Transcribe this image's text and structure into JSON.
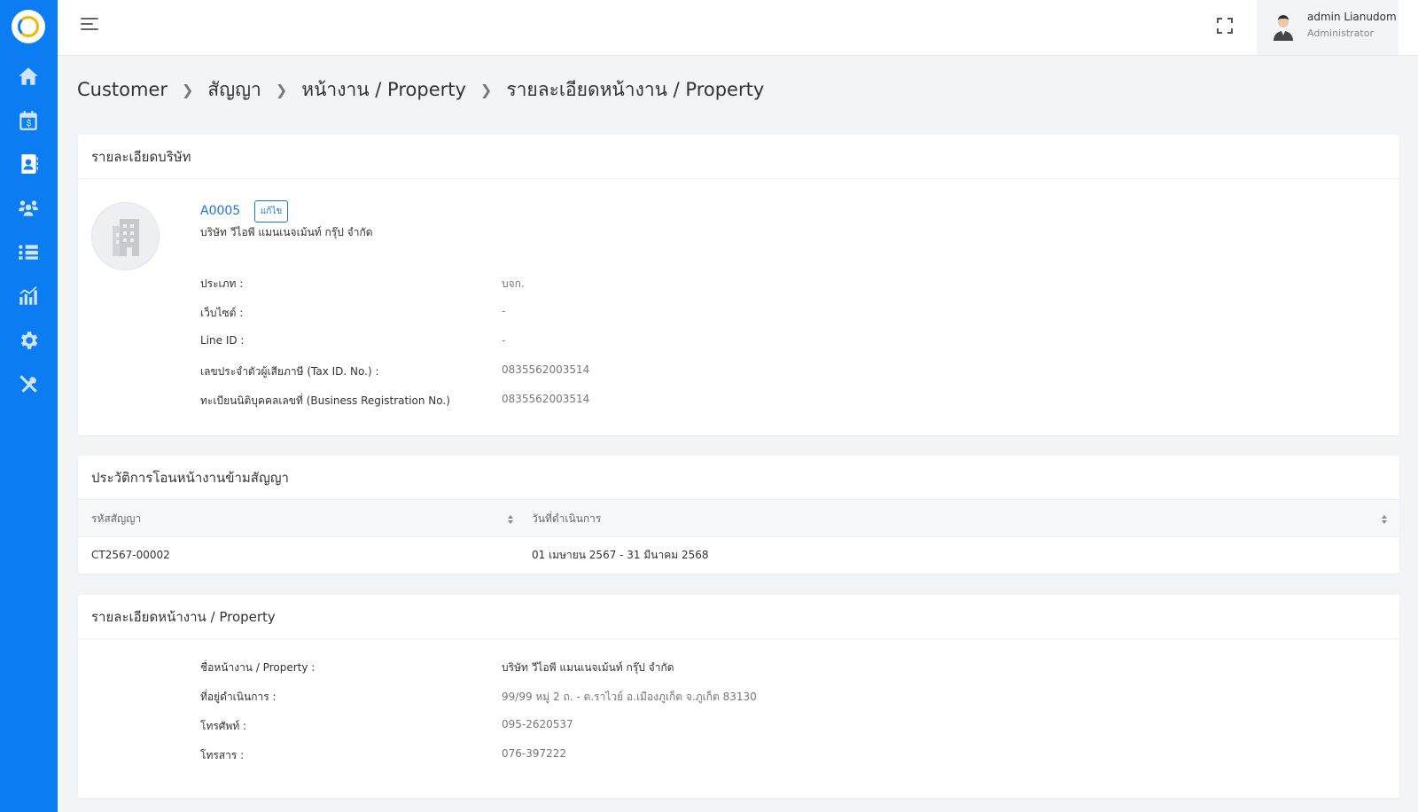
{
  "header": {
    "user_name": "admin Lianudom",
    "user_role": "Administrator"
  },
  "sidebar": {
    "items": [
      {
        "icon": "home-icon"
      },
      {
        "icon": "calendar-dollar-icon"
      },
      {
        "icon": "address-book-icon"
      },
      {
        "icon": "users-gear-icon"
      },
      {
        "icon": "list-icon"
      },
      {
        "icon": "chart-icon"
      },
      {
        "icon": "gear-icon"
      },
      {
        "icon": "tools-icon"
      }
    ]
  },
  "breadcrumb": [
    "Customer",
    "สัญญา",
    "หน้างาน / Property",
    "รายละเอียดหน้างาน / Property"
  ],
  "company_card": {
    "title": "รายละเอียดบริษัท",
    "code": "A0005",
    "edit_label": "แก้ไข",
    "name": "บริษัท วีไอพี แมนเนจเม้นท์ กรุ๊ป จำกัด",
    "fields": [
      {
        "label": "ประเภท :",
        "value": "บจก."
      },
      {
        "label": "เว็บไซต์ :",
        "value": "-"
      },
      {
        "label": "Line ID :",
        "value": "-"
      },
      {
        "label": "เลขประจำตัวผู้เสียภาษี (Tax ID. No.) :",
        "value": "0835562003514"
      },
      {
        "label": "ทะเบียนนิติบุคคลเลขที่ (Business Registration No.)",
        "value": "0835562003514"
      }
    ]
  },
  "history_card": {
    "title": "ประวัติการโอนหน้างานข้ามสัญญา",
    "columns": [
      "รหัสสัญญา",
      "วันที่ดำเนินการ"
    ],
    "rows": [
      {
        "contract": "CT2567-00002",
        "period": "01 เมษายน 2567 - 31 มีนาคม 2568"
      }
    ]
  },
  "property_card": {
    "title": "รายละเอียดหน้างาน / Property",
    "fields": [
      {
        "label": "ชื่อหน้างาน / Property :",
        "value": "บริษัท วีไอพี แมนเนจเม้นท์ กรุ๊ป จำกัด"
      },
      {
        "label": "ที่อยู่ดำเนินการ :",
        "value": "99/99 หมู่ 2 ถ. - ต.ราไวย์ อ.เมืองภูเก็ต จ.ภูเก็ต 83130"
      },
      {
        "label": "โทรศัพท์ :",
        "value": "095-2620537"
      },
      {
        "label": "โทรสาร :",
        "value": "076-397222"
      }
    ]
  },
  "colors": {
    "sidebar": "#0b7cf2",
    "link": "#1a73e8",
    "background": "#f3f4f8"
  }
}
